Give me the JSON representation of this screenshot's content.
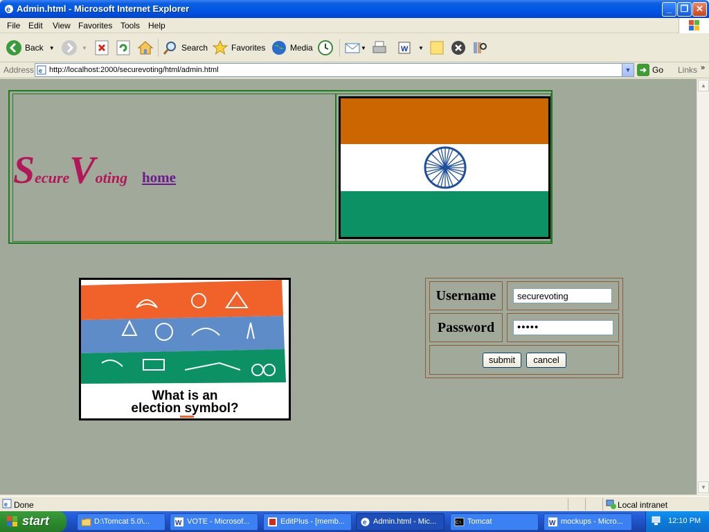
{
  "window": {
    "title": "Admin.html - Microsoft Internet Explorer"
  },
  "menu": {
    "items": [
      "File",
      "Edit",
      "View",
      "Favorites",
      "Tools",
      "Help"
    ]
  },
  "toolbar": {
    "back_label": "Back",
    "search_label": "Search",
    "favorites_label": "Favorites",
    "media_label": "Media"
  },
  "address": {
    "label": "Address",
    "url": "http://localhost:2000/securevoting/html/admin.html",
    "go_label": "Go",
    "links_label": "Links"
  },
  "page": {
    "brand": {
      "s": "S",
      "ecure": "ecure",
      "v": "V",
      "oting": "oting"
    },
    "home_link": "home",
    "symbol_caption_line1": "What is an",
    "symbol_caption_line2": "election symbol?",
    "login": {
      "username_label": "Username",
      "username_value": "securevoting",
      "password_label": "Password",
      "password_value": "•••••",
      "submit_label": "submit",
      "cancel_label": "cancel"
    },
    "colors": {
      "background": "#a0a99a",
      "brand": "#b01858",
      "link": "#6a1a8a",
      "saffron": "#cc6600",
      "green": "#0c9164",
      "chakra": "#1e4f9a"
    }
  },
  "status": {
    "text": "Done",
    "zone": "Local intranet"
  },
  "taskbar": {
    "start_label": "start",
    "tasks": [
      {
        "label": "D:\\Tomcat 5.0\\...",
        "icon": "folder-icon"
      },
      {
        "label": "VOTE - Microsof...",
        "icon": "word-icon"
      },
      {
        "label": "EditPlus - [memb...",
        "icon": "editplus-icon"
      },
      {
        "label": "Admin.html - Mic...",
        "icon": "ie-icon",
        "active": true
      },
      {
        "label": "Tomcat",
        "icon": "console-icon"
      },
      {
        "label": "mockups - Micro...",
        "icon": "word-icon"
      }
    ],
    "clock": "12:10 PM"
  }
}
